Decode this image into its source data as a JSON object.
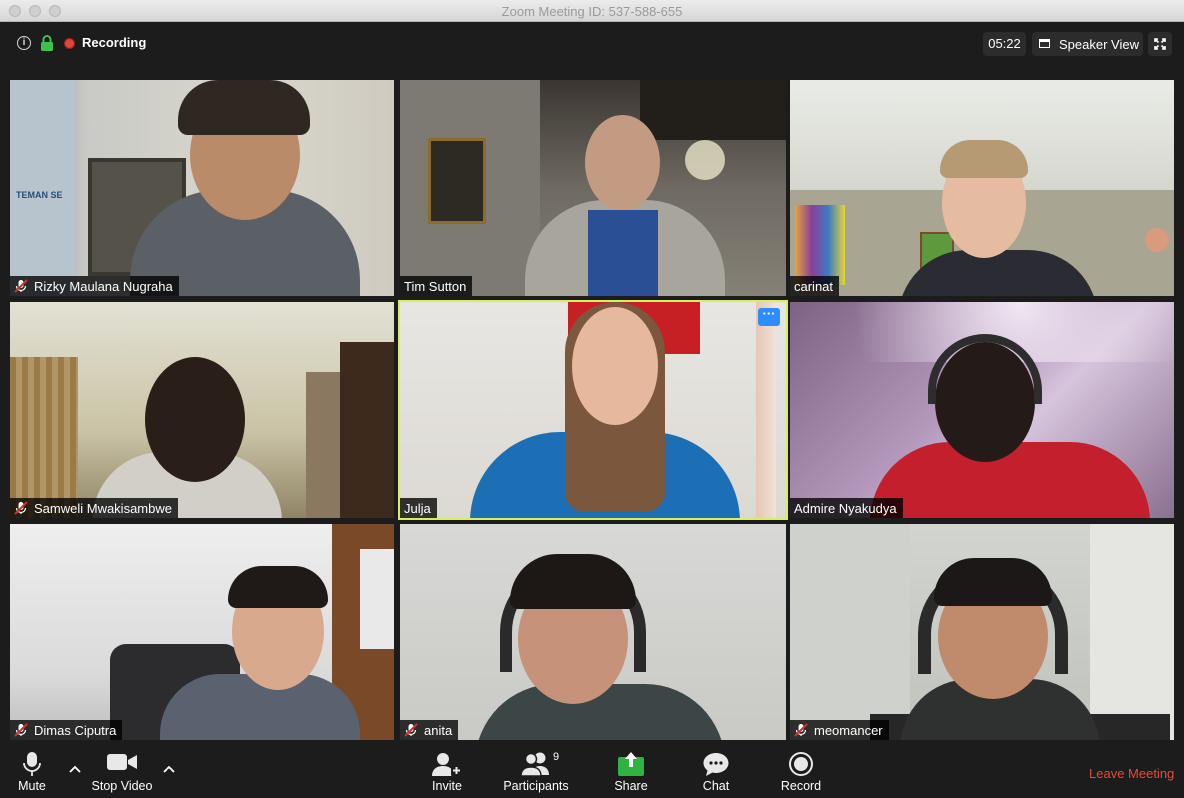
{
  "window": {
    "title": "Zoom Meeting ID: 537-588-655"
  },
  "topbar": {
    "info_icon": "info-icon",
    "lock_icon": "lock-icon",
    "recording_label": "Recording",
    "timer": "05:22",
    "view_label": "Speaker View",
    "fullscreen_icon": "fullscreen-icon"
  },
  "participants": [
    {
      "name": "Rizky Maulana Nugraha",
      "muted": true,
      "active": false
    },
    {
      "name": "Tim Sutton",
      "muted": false,
      "active": false
    },
    {
      "name": "carinat",
      "muted": false,
      "active": false
    },
    {
      "name": "Samweli Mwakisambwe",
      "muted": true,
      "active": false
    },
    {
      "name": "Julja",
      "muted": false,
      "active": true
    },
    {
      "name": "Admire Nyakudya",
      "muted": false,
      "active": false
    },
    {
      "name": "Dimas Ciputra",
      "muted": true,
      "active": false
    },
    {
      "name": "anita",
      "muted": true,
      "active": false
    },
    {
      "name": "meomancer",
      "muted": true,
      "active": false
    }
  ],
  "tile_more_icon": "more-options-icon",
  "toolbar": {
    "mute_label": "Mute",
    "video_label": "Stop Video",
    "invite_label": "Invite",
    "participants_label": "Participants",
    "participants_count": "9",
    "share_label": "Share",
    "chat_label": "Chat",
    "record_label": "Record",
    "leave_label": "Leave Meeting"
  },
  "colors": {
    "active_speaker_border": "#d7ef5c",
    "share_green": "#2fb442",
    "leave_red": "#e64a3b",
    "more_button_blue": "#2d8cff"
  }
}
